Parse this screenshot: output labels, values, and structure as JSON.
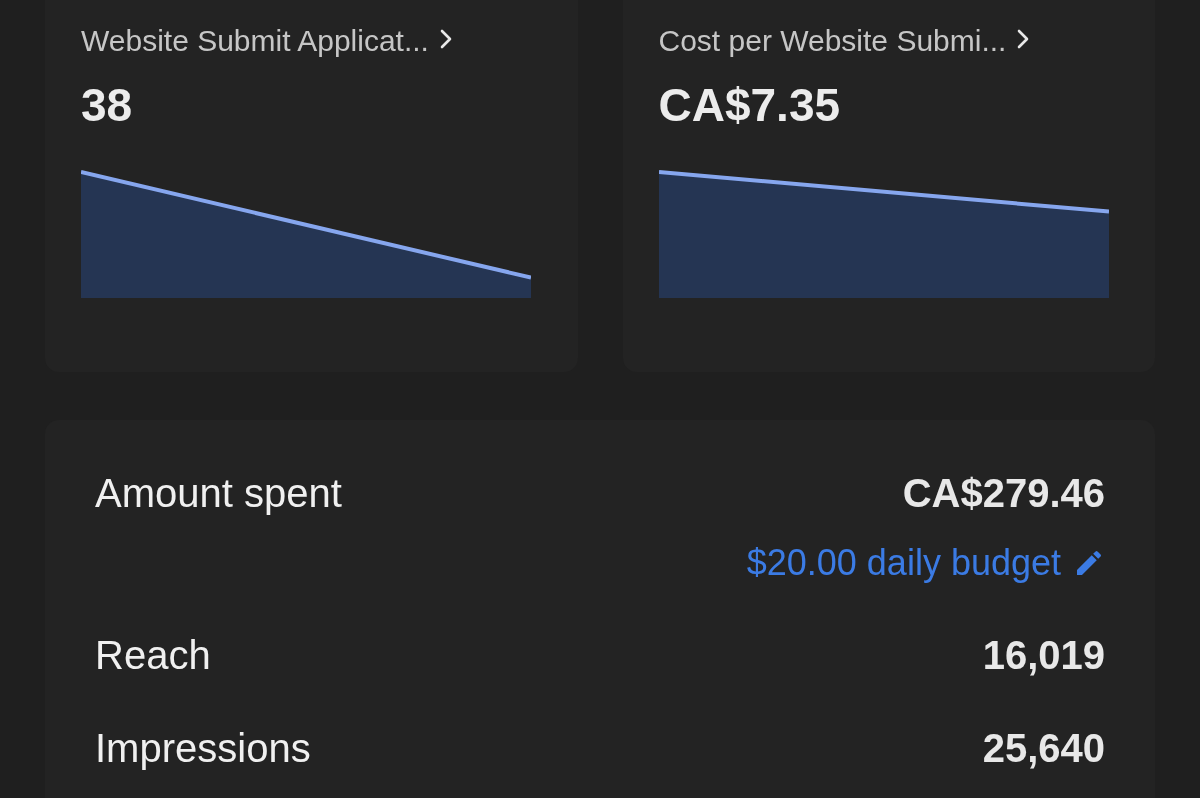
{
  "metric_cards": [
    {
      "title": "Website Submit Applicat...",
      "value": "38"
    },
    {
      "title": "Cost per Website Submi...",
      "value": "CA$7.35"
    }
  ],
  "summary": {
    "rows": [
      {
        "label": "Amount spent",
        "value": "CA$279.46",
        "link": "$20.00 daily budget"
      },
      {
        "label": "Reach",
        "value": "16,019"
      },
      {
        "label": "Impressions",
        "value": "25,640"
      }
    ]
  }
}
